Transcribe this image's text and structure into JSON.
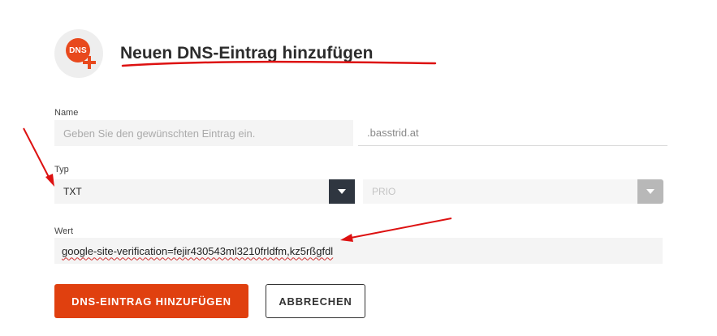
{
  "header": {
    "badge_text": "DNS",
    "title": "Neuen DNS-Eintrag hinzufügen"
  },
  "form": {
    "name_label": "Name",
    "name_placeholder": "Geben Sie den gewünschten Eintrag ein.",
    "domain_suffix": ".basstrid.at",
    "type_label": "Typ",
    "type_value": "TXT",
    "prio_placeholder": "PRIO",
    "value_label": "Wert",
    "value_value": "google-site-verification=fejir430543ml3210frldfm,kz5rßgfdl"
  },
  "actions": {
    "submit_label": "DNS-EINTRAG HINZUFÜGEN",
    "cancel_label": "ABBRECHEN"
  },
  "colors": {
    "accent": "#e0400f",
    "annotation": "#dd1111",
    "select_button": "#2f3640",
    "disabled_button": "#b8b8b8"
  },
  "icons": {
    "dns_add": "dns-add-icon",
    "select_arrow": "chevron-down-icon"
  }
}
